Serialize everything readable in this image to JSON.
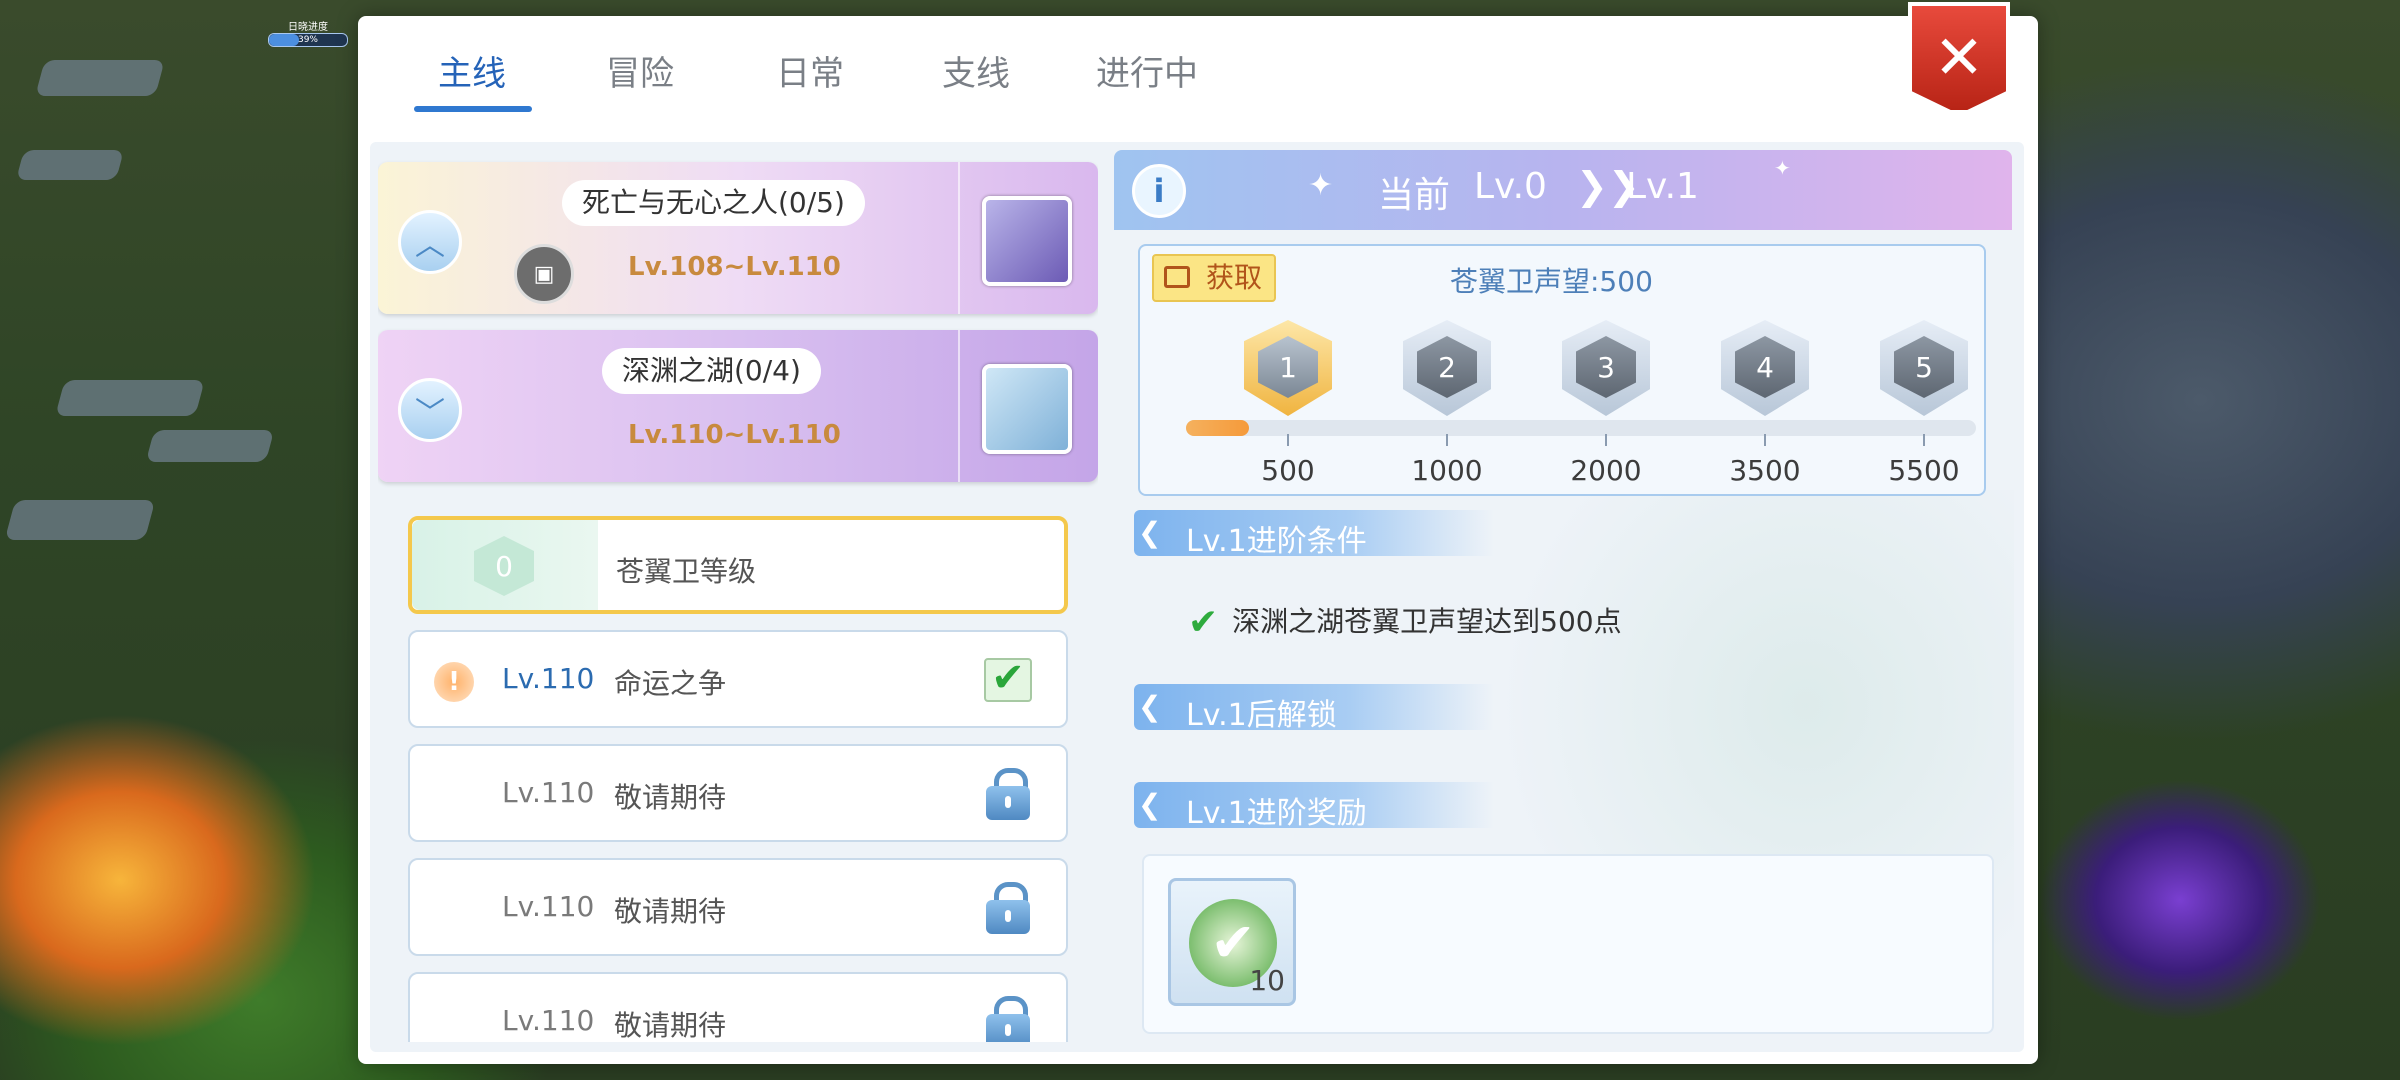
{
  "hud": {
    "label": "日晓进度",
    "percent_text": "39%",
    "percent": 0.39
  },
  "tabs": [
    {
      "label": "主线",
      "active": true
    },
    {
      "label": "冒险",
      "active": false
    },
    {
      "label": "日常",
      "active": false
    },
    {
      "label": "支线",
      "active": false
    },
    {
      "label": "进行中",
      "active": false
    }
  ],
  "close_label": "✕",
  "chapters": [
    {
      "title": "死亡与无心之人(0/5)",
      "level": "Lv.108~Lv.110"
    },
    {
      "title": "深渊之湖(0/4)",
      "level": "Lv.110~Lv.110"
    }
  ],
  "quests": [
    {
      "badge": "0",
      "name": "苍翼卫等级"
    },
    {
      "level": "Lv.110",
      "name": "命运之争",
      "status": "done"
    },
    {
      "level": "Lv.110",
      "name": "敬请期待",
      "status": "locked"
    },
    {
      "level": "Lv.110",
      "name": "敬请期待",
      "status": "locked"
    },
    {
      "level": "Lv.110",
      "name": "敬请期待",
      "status": "locked"
    }
  ],
  "detail": {
    "info_icon": "i",
    "current_label": "当前",
    "from_level": "Lv.0",
    "arrow": "❯❯",
    "to_level": "Lv.1",
    "get_button": "获取",
    "reputation_label": "苍翼卫声望:500",
    "progress": 0.08,
    "milestones": [
      {
        "rank": "1",
        "value": "500"
      },
      {
        "rank": "2",
        "value": "1000"
      },
      {
        "rank": "3",
        "value": "2000"
      },
      {
        "rank": "4",
        "value": "3500"
      },
      {
        "rank": "5",
        "value": "5500"
      }
    ],
    "condition_title": "Lv.1进阶条件",
    "condition_text": "深渊之湖苍翼卫声望达到500点",
    "unlock_title": "Lv.1后解锁",
    "reward_title": "Lv.1进阶奖励",
    "reward_qty": "10"
  },
  "colors": {
    "accent": "#2f78d0",
    "close": "#d93a2b",
    "progress": "#f5a547"
  }
}
